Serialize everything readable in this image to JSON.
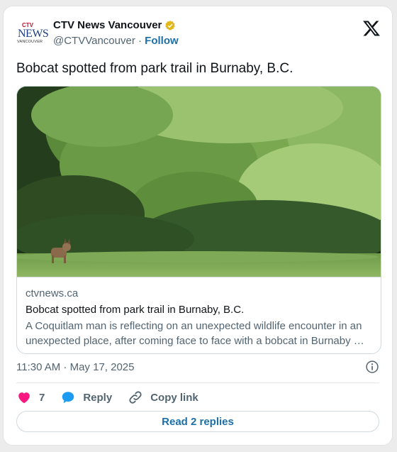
{
  "account": {
    "logo": {
      "line1": "CTV",
      "line2": "NEWS",
      "line3": "VANCOUVER"
    },
    "name": "CTV News Vancouver",
    "handle": "@CTVVancouver",
    "separator": "·",
    "follow_label": "Follow"
  },
  "tweet": {
    "text": "Bobcat spotted from park trail in Burnaby, B.C."
  },
  "link_card": {
    "domain": "ctvnews.ca",
    "headline": "Bobcat spotted from park trail in Burnaby, B.C.",
    "description": "A Coquitlam man is reflecting on an unexpected wildlife encounter in an unexpected place, after coming face to face with a bobcat in Burnaby …"
  },
  "timestamp": "11:30 AM · May 17, 2025",
  "actions": {
    "like_count": "7",
    "reply_label": "Reply",
    "copy_link_label": "Copy link"
  },
  "read_replies_label": "Read 2 replies",
  "colors": {
    "accent": "#1d6fa5",
    "like": "#f91880",
    "verified": "#e2b719"
  },
  "icons": [
    "x-logo-icon",
    "verified-badge-icon",
    "info-icon",
    "heart-icon",
    "reply-bubble-icon",
    "link-icon"
  ]
}
